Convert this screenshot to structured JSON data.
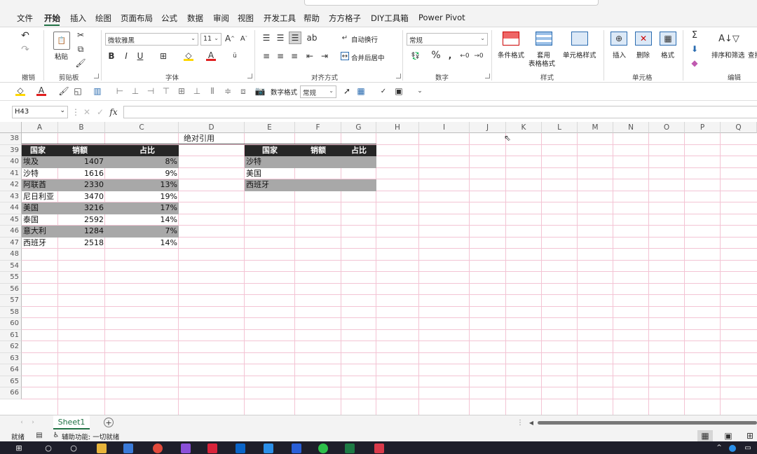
{
  "menu": {
    "items": [
      "文件",
      "开始",
      "插入",
      "绘图",
      "页面布局",
      "公式",
      "数据",
      "审阅",
      "视图",
      "开发工具",
      "帮助",
      "方方格子",
      "DIY工具箱",
      "Power Pivot"
    ],
    "active": "开始"
  },
  "ribbon": {
    "paste": "粘贴",
    "undo_group": "撤销",
    "clipboard_group": "剪贴板",
    "font_name": "微软雅黑",
    "font_size": "11",
    "font_group": "字体",
    "wrap_text": "自动换行",
    "merge_center": "合并后居中",
    "align_group": "对齐方式",
    "number_format": "常规",
    "number_group": "数字",
    "conditional_format": "条件格式",
    "table_format_1": "套用",
    "table_format_2": "表格格式",
    "cell_style": "单元格样式",
    "style_group": "样式",
    "insert": "插入",
    "delete": "删除",
    "format": "格式",
    "cells_group": "单元格",
    "sort_filter": "排序和筛选",
    "find": "查找",
    "edit_group": "编辑"
  },
  "quickbar": {
    "number_format_label": "数字格式",
    "number_format_value": "常规"
  },
  "formula_bar": {
    "name_box": "H43",
    "formula": ""
  },
  "grid": {
    "columns": [
      "A",
      "B",
      "C",
      "D",
      "E",
      "F",
      "G",
      "H",
      "I",
      "J",
      "K",
      "L",
      "M",
      "N",
      "O",
      "P",
      "Q"
    ],
    "rows": [
      "38",
      "39",
      "40",
      "41",
      "42",
      "43",
      "44",
      "45",
      "46",
      "47",
      "48",
      "54",
      "55",
      "56",
      "57",
      "58",
      "60",
      "61",
      "62",
      "63",
      "64",
      "65",
      "66"
    ],
    "title": "绝对引用",
    "table1": {
      "headers": [
        "国家",
        "销额",
        "占比"
      ],
      "rows": [
        {
          "country": "埃及",
          "sales": "1407",
          "share": "8%"
        },
        {
          "country": "沙特",
          "sales": "1616",
          "share": "9%"
        },
        {
          "country": "阿联酋",
          "sales": "2330",
          "share": "13%"
        },
        {
          "country": "尼日利亚",
          "sales": "3470",
          "share": "19%"
        },
        {
          "country": "美国",
          "sales": "3216",
          "share": "17%"
        },
        {
          "country": "泰国",
          "sales": "2592",
          "share": "14%"
        },
        {
          "country": "意大利",
          "sales": "1284",
          "share": "7%"
        },
        {
          "country": "西班牙",
          "sales": "2518",
          "share": "14%"
        }
      ]
    },
    "table2": {
      "headers": [
        "国家",
        "销额",
        "占比"
      ],
      "rows": [
        "沙特",
        "美国",
        "西班牙"
      ]
    }
  },
  "sheets": {
    "tab": "Sheet1"
  },
  "status": {
    "ready": "就绪",
    "accessibility": "辅助功能: 一切就绪"
  },
  "colors": {
    "accent": "#217346",
    "header_fill": "#262626",
    "highlight_fill": "#a8a8a8",
    "gridline": "#f3c4d4"
  }
}
